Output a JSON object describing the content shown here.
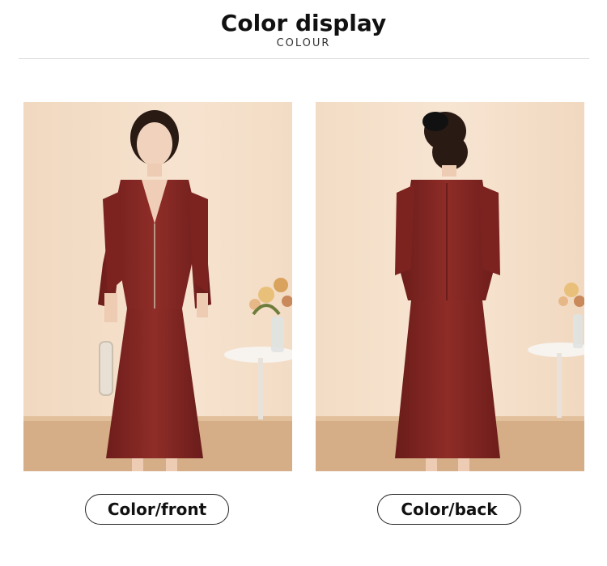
{
  "header": {
    "title": "Color display",
    "subtitle": "COLOUR"
  },
  "views": [
    {
      "label": "Color/front",
      "image": "model-front-photo"
    },
    {
      "label": "Color/back",
      "image": "model-back-photo"
    }
  ],
  "colors": {
    "garment": "#8a2a26",
    "background_wall": "#f2dcc6",
    "floor": "#d6b08a"
  }
}
